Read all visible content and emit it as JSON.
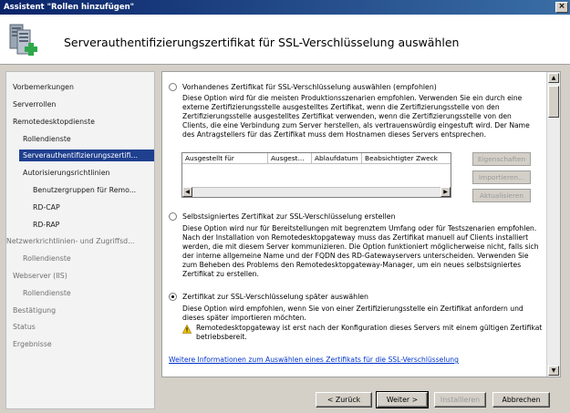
{
  "window": {
    "title": "Assistent \"Rollen hinzufügen\"",
    "close_label": "×"
  },
  "header": {
    "title": "Serverauthentifizierungszertifikat für SSL-Verschlüsselung auswählen"
  },
  "sidebar": {
    "items": [
      {
        "label": "Vorbemerkungen",
        "state": "normal"
      },
      {
        "label": "Serverrollen",
        "state": "normal"
      },
      {
        "label": "Remotedesktopdienste",
        "state": "normal"
      },
      {
        "label": "Rollendienste",
        "state": "normal"
      },
      {
        "label": "Serverauthentifizierungszertifi...",
        "state": "selected"
      },
      {
        "label": "Autorisierungsrichtlinien",
        "state": "normal"
      },
      {
        "label": "Benutzergruppen für Remo...",
        "state": "normal"
      },
      {
        "label": "RD-CAP",
        "state": "normal"
      },
      {
        "label": "RD-RAP",
        "state": "normal"
      },
      {
        "label": "Netzwerkrichtlinien- und Zugriffsd...",
        "state": "dim"
      },
      {
        "label": "Rollendienste",
        "state": "dim"
      },
      {
        "label": "Webserver (IIS)",
        "state": "dim"
      },
      {
        "label": "Rollendienste",
        "state": "dim"
      },
      {
        "label": "Bestätigung",
        "state": "dim"
      },
      {
        "label": "Status",
        "state": "dim"
      },
      {
        "label": "Ergebnisse",
        "state": "dim"
      }
    ]
  },
  "options": {
    "existing": {
      "label": "Vorhandenes Zertifikat für SSL-Verschlüsselung auswählen (empfohlen)",
      "checked": false,
      "desc": [
        "Diese Option wird für die meisten Produktionsszenarien empfohlen. Verwenden Sie ein durch eine",
        "externe Zertifizierungsstelle ausgestelltes Zertifikat, wenn die Zertifizierungsstelle von den",
        "Clients, die eine Verbindung zum Server herstellen, als vertrauenswürdig eingestuft wird. Der Name",
        "des Antragstellers für das Zertifikat muss dem Hostnamen dieses Servers entsprechen.",
        "Zertifizierungsstelle ausgestelltes Zertifikat verwenden, wenn die Zertifizierungsstelle von den"
      ]
    },
    "self_signed": {
      "label": "Selbstsigniertes Zertifikat zur SSL-Verschlüsselung erstellen",
      "checked": false,
      "desc": [
        "Diese Option wird nur für Bereitstellungen mit begrenztem Umfang oder für Testszenarien empfohlen.",
        "Nach der Installation von Remotedesktopgateway muss das Zertifikat manuell auf Clients installiert",
        "werden, die mit diesem Server kommunizieren. Die Option funktioniert möglicherweise nicht, falls sich",
        "der interne allgemeine Name und der FQDN des RD-Gatewayservers unterscheiden. Verwenden Sie",
        "zum Beheben des Problems den Remotedesktopgateway-Manager, um ein neues selbstsigniertes",
        "Zertifikat zu erstellen."
      ]
    },
    "later": {
      "label": "Zertifikat zur SSL-Verschlüsselung später auswählen",
      "checked": true,
      "desc": [
        "Diese Option wird empfohlen, wenn Sie von einer Zertifizierungsstelle ein Zertifikat anfordern und",
        "dieses später importieren möchten."
      ],
      "warning": [
        "Remotedesktopgateway ist erst nach der Konfiguration dieses Servers mit einem gültigen Zertifikat",
        "betriebsbereit."
      ]
    }
  },
  "cert_table": {
    "columns": [
      "Ausgestellt für",
      "Ausgest...",
      "Ablaufdatum",
      "Beabsichtigter Zweck"
    ]
  },
  "side_buttons": {
    "properties": "Eigenschaften",
    "import": "Importieren...",
    "refresh": "Aktualisieren"
  },
  "more_info_link": "Weitere Informationen zum Auswählen eines Zertifikats für die SSL-Verschlüsselung",
  "footer": {
    "back": "< Zurück",
    "next": "Weiter >",
    "install": "Installieren",
    "cancel": "Abbrechen"
  },
  "icons": [
    "server-wizard-icon",
    "warning-icon",
    "close-icon",
    "scroll-left-icon",
    "scroll-right-icon",
    "scroll-up-icon",
    "scroll-down-icon"
  ]
}
